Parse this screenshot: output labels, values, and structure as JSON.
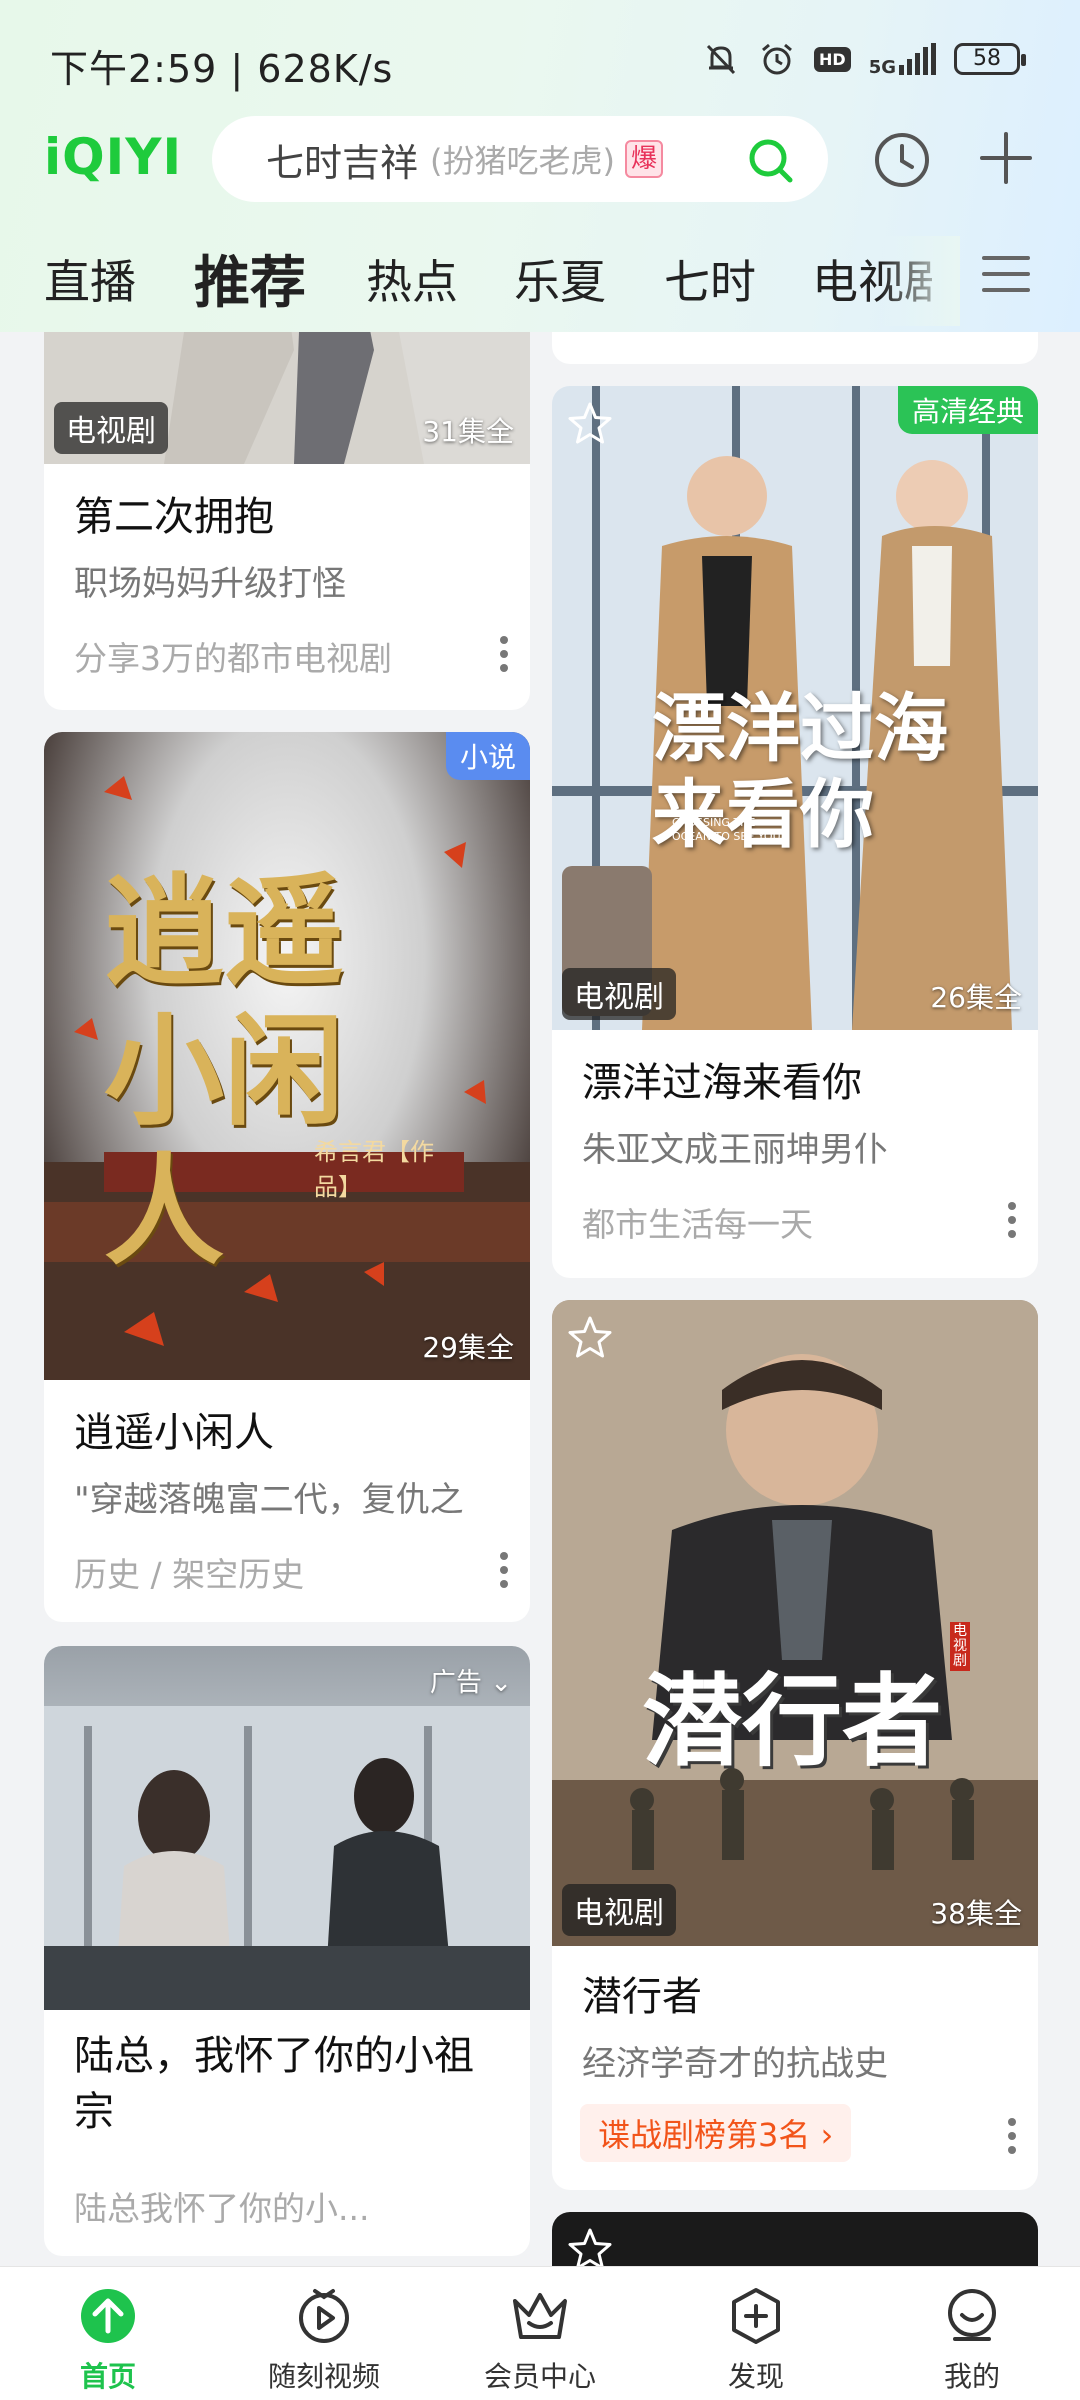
{
  "status": {
    "time_speed": "下午2:59 | 628K/s",
    "network": "5G",
    "hd": "HD",
    "battery": "58"
  },
  "header": {
    "logo": "iQIYI",
    "search_main": "七时吉祥",
    "search_sub": "(扮猪吃老虎)",
    "search_badge": "爆"
  },
  "tabs": [
    "直播",
    "推荐",
    "热点",
    "乐夏",
    "七时",
    "电视剧"
  ],
  "active_tab": "推荐",
  "cards": {
    "c1": {
      "tag": "电视剧",
      "episodes": "31集全",
      "title": "第二次拥抱",
      "subtitle": "职场妈妈升级打怪",
      "meta": "分享3万的都市电视剧"
    },
    "c2": {
      "corner": "小说",
      "episodes": "29集全",
      "title": "逍遥小闲人",
      "subtitle": "\"穿越落魄富二代，复仇之",
      "meta": "历史 / 架空历史",
      "poster_text": "逍遥小闲人",
      "poster_small": "希言君【作品】"
    },
    "c3": {
      "ad": "广告",
      "title": "陆总，我怀了你的小祖宗",
      "meta": "陆总我怀了你的小..."
    },
    "c4": {
      "corner": "高清经典",
      "tag": "电视剧",
      "episodes": "26集全",
      "title": "漂洋过海来看你",
      "subtitle": "朱亚文成王丽坤男仆",
      "meta": "都市生活每一天",
      "poster_text": "漂洋过海来看你",
      "poster_en": "CROSSING THE OCEAN TO SEE YOU"
    },
    "c5": {
      "tag": "电视剧",
      "episodes": "38集全",
      "title": "潜行者",
      "subtitle": "经济学奇才的抗战史",
      "rank": "谍战剧榜第3名",
      "poster_text": "潜行者",
      "poster_small": "电视剧"
    }
  },
  "nav": [
    {
      "label": "首页",
      "icon": "home-icon"
    },
    {
      "label": "随刻视频",
      "icon": "play-icon"
    },
    {
      "label": "会员中心",
      "icon": "crown-icon"
    },
    {
      "label": "发现",
      "icon": "discover-icon"
    },
    {
      "label": "我的",
      "icon": "profile-icon"
    }
  ],
  "colors": {
    "brand": "#1ecb3c",
    "rank": "#f2541a",
    "corner_green": "#2bc356",
    "corner_blue": "#5a8cf0"
  }
}
